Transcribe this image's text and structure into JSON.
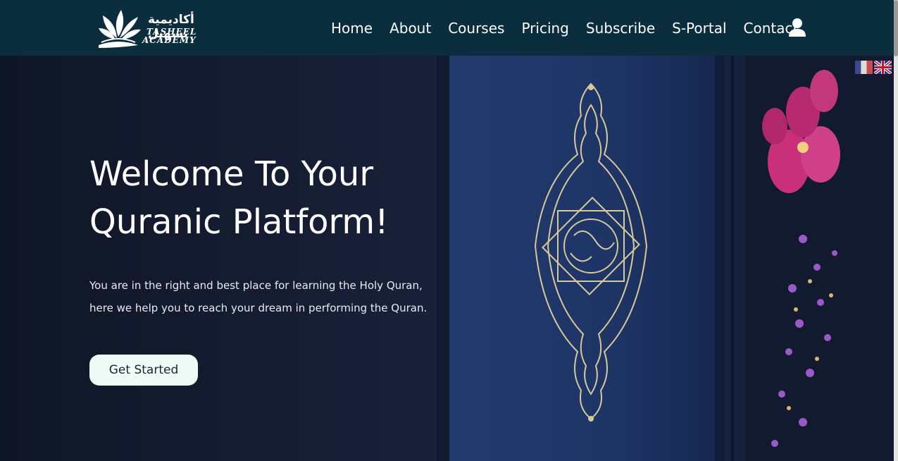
{
  "brand": {
    "arabic_name": "أكاديمية تسهيل",
    "name_line1": "TASHEEL",
    "name_line2": "ACADEMY"
  },
  "nav": {
    "items": [
      {
        "label": "Home"
      },
      {
        "label": "About"
      },
      {
        "label": "Courses"
      },
      {
        "label": "Pricing"
      },
      {
        "label": "Subscribe"
      },
      {
        "label": "S-Portal"
      },
      {
        "label": "Contact"
      }
    ],
    "user_icon": "user-icon"
  },
  "hero": {
    "title": "Welcome To Your Quranic Platform!",
    "text": "You are in the right and best place for learning the Holy Quran, here we help you to reach your dream in performing the Quran.",
    "cta_label": "Get Started"
  },
  "languages": [
    {
      "icon": "flag-france-icon"
    },
    {
      "icon": "flag-uk-icon"
    }
  ],
  "colors": {
    "navbar": "#0a2e3e",
    "hero_bg": "#141a2c",
    "cta_bg": "#f0fbf8",
    "book": "#1e3566",
    "gold": "#d8c89a",
    "flower": "#c8307a"
  }
}
